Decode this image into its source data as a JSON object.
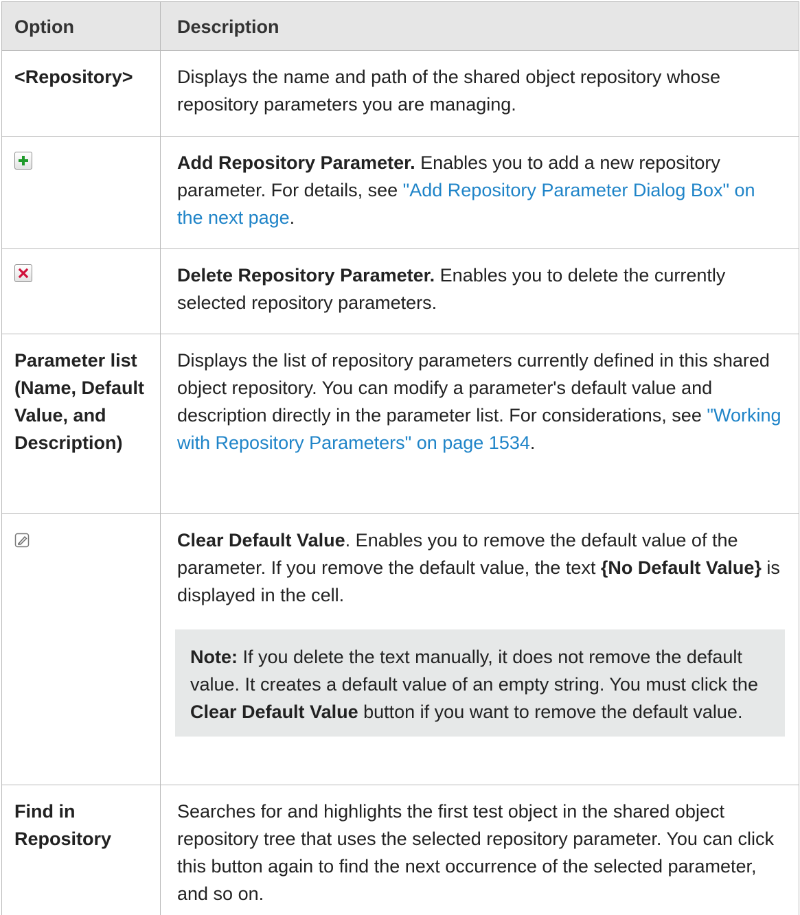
{
  "header": {
    "option": "Option",
    "description": "Description"
  },
  "rows": {
    "repository": {
      "option": "<Repository>",
      "description": "Displays the name and path of the shared object repository whose repository parameters you are managing."
    },
    "add": {
      "icon": "add-plus-icon",
      "title": "Add Repository Parameter.",
      "text": " Enables you to add a new repository parameter. For details, see ",
      "link": "\"Add Repository Parameter Dialog Box\" on the next page",
      "end": "."
    },
    "delete": {
      "icon": "delete-x-icon",
      "title": "Delete Repository Parameter.",
      "text": " Enables you to delete the currently selected repository parameters."
    },
    "paramlist": {
      "option": "Parameter list (Name, Default Value, and Description)",
      "text": "Displays the list of repository parameters currently defined in this shared object repository. You can modify a parameter's default value and description directly in the parameter list. For considerations, see ",
      "link": "\"Working with Repository Parameters\" on page 1534",
      "end": "."
    },
    "clear": {
      "icon": "eraser-icon",
      "title": "Clear Default Value",
      "text1": ". Enables you to remove the default value of the parameter. If you remove the default value, the text ",
      "bold2": "{No Default Value}",
      "text2": " is displayed in the cell.",
      "note_label": "Note:",
      "note_text1": " If you delete the text manually, it does not remove the default value. It creates a default value of an empty string. You must click the ",
      "note_bold": "Clear Default Value",
      "note_text2": " button if you want to remove the default value."
    },
    "find": {
      "option": "Find in Repository",
      "description": "Searches for and highlights the first test object in the shared object repository tree that uses the selected repository parameter. You can click this button again to find the next occurrence of the selected parameter, and so on."
    }
  },
  "colors": {
    "header_bg": "#e6e6e6",
    "note_bg": "#e6e8e8",
    "link": "#1f84c8",
    "border": "#b9b9b9"
  }
}
